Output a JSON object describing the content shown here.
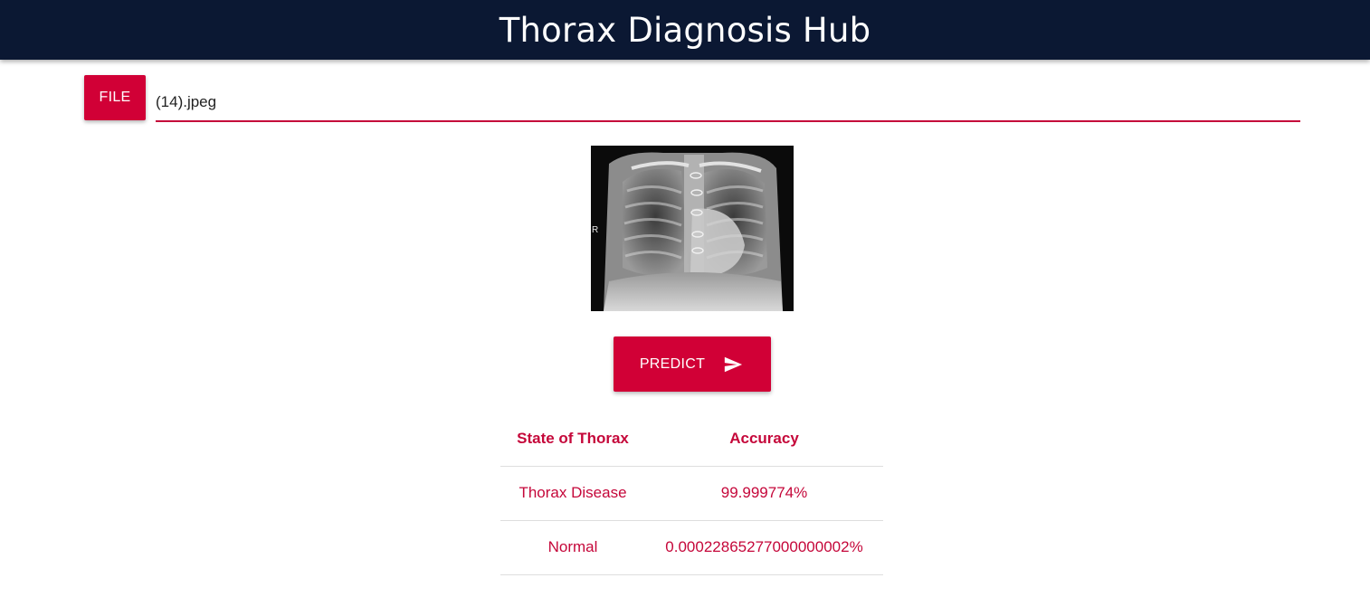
{
  "header": {
    "title": "Thorax Diagnosis Hub"
  },
  "upload": {
    "file_button_label": "FILE",
    "file_name": "(14).jpeg"
  },
  "preview": {
    "image_alt": "chest x-ray preview",
    "marker_text": "R"
  },
  "actions": {
    "predict_label": "PREDICT"
  },
  "results": {
    "headers": [
      "State of Thorax",
      "Accuracy"
    ],
    "rows": [
      [
        "Thorax Disease",
        "99.999774%"
      ],
      [
        "Normal",
        "0.00022865277000000002%"
      ]
    ]
  },
  "colors": {
    "header_bg": "#0b1833",
    "accent": "#d10036",
    "text_accent": "#c5073a"
  }
}
